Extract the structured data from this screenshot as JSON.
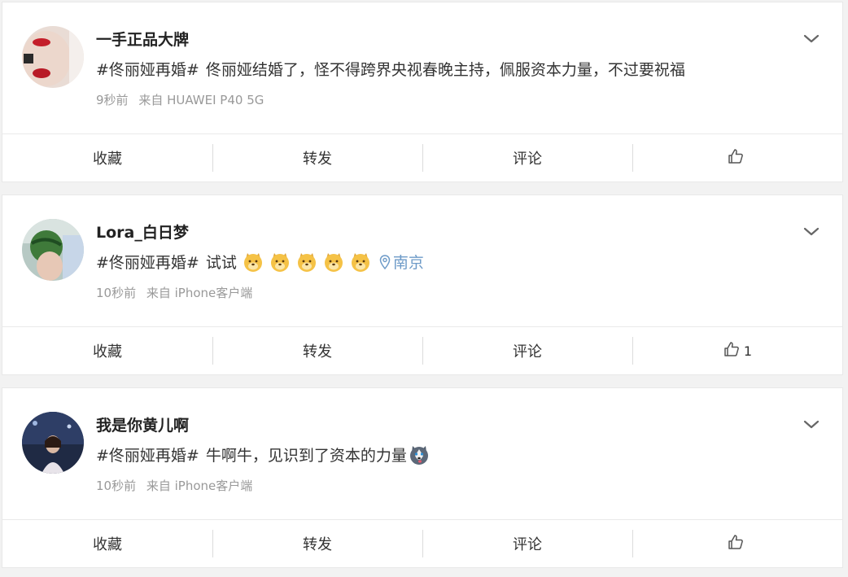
{
  "posts": [
    {
      "username": "一手正品大牌",
      "hashtag": "#佟丽娅再婚#",
      "text": "佟丽娅结婚了，怪不得跨界央视春晚主持，佩服资本力量，不过要祝福",
      "time": "9秒前",
      "source": "来自 HUAWEI P40 5G",
      "actions": {
        "favorite": "收藏",
        "repost": "转发",
        "comment": "评论",
        "like_count": ""
      },
      "emojis": [],
      "location": ""
    },
    {
      "username": "Lora_白日梦",
      "hashtag": "#佟丽娅再婚#",
      "text": "试试",
      "time": "10秒前",
      "source": "来自 iPhone客户端",
      "actions": {
        "favorite": "收藏",
        "repost": "转发",
        "comment": "评论",
        "like_count": "1"
      },
      "emojis": [
        "doge-icon",
        "doge-icon",
        "doge-icon",
        "doge-icon",
        "doge-icon"
      ],
      "location": "南京"
    },
    {
      "username": "我是你黄儿啊",
      "hashtag": "#佟丽娅再婚#",
      "text": "牛啊牛，见识到了资本的力量",
      "time": "10秒前",
      "source": "来自 iPhone客户端",
      "actions": {
        "favorite": "收藏",
        "repost": "转发",
        "comment": "评论",
        "like_count": ""
      },
      "emojis": [
        "husky-icon"
      ],
      "location": ""
    }
  ],
  "colors": {
    "background": "#f2f2f2",
    "card": "#ffffff",
    "location": "#6e9bc8",
    "meta": "#999999"
  }
}
